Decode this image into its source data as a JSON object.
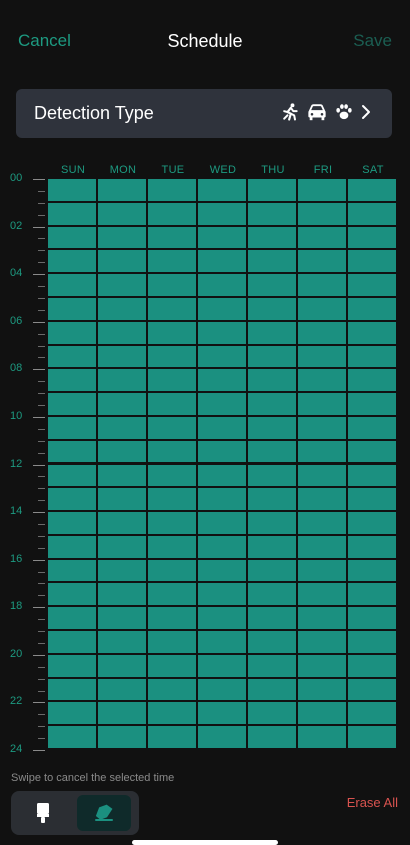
{
  "header": {
    "cancel_label": "Cancel",
    "title": "Schedule",
    "save_label": "Save"
  },
  "detection": {
    "label": "Detection Type",
    "icons": [
      "person-running-icon",
      "car-icon",
      "paw-icon",
      "chevron-right-icon"
    ]
  },
  "days": [
    "SUN",
    "MON",
    "TUE",
    "WED",
    "THU",
    "FRI",
    "SAT"
  ],
  "hour_labels": [
    "00",
    "02",
    "04",
    "06",
    "08",
    "10",
    "12",
    "14",
    "16",
    "18",
    "20",
    "22",
    "24"
  ],
  "schedule": {
    "hours": 24,
    "rows_per_hour": 1,
    "all_selected": true,
    "selected_color": "#1b9080"
  },
  "footer": {
    "hint": "Swipe to cancel the selected time",
    "tools": [
      "brush-icon",
      "eraser-icon"
    ],
    "active_tool": "eraser",
    "erase_all_label": "Erase All"
  },
  "colors": {
    "accent": "#1d9a81",
    "background": "#111111",
    "erase": "#d9534f"
  }
}
